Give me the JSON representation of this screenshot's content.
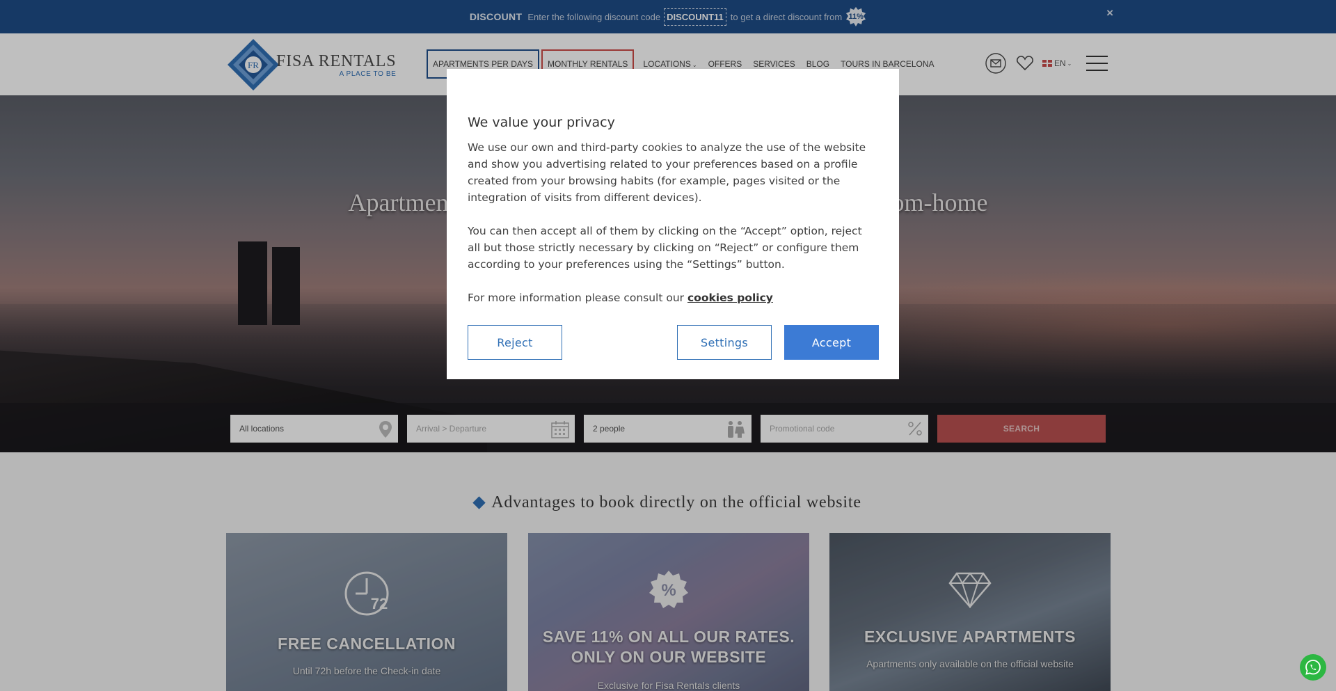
{
  "topbar": {
    "label": "DISCOUNT",
    "text_before": "Enter the following discount code",
    "code": "DISCOUNT11",
    "text_after": "to get a direct discount from",
    "badge": "11%",
    "close": "×"
  },
  "header": {
    "logo_mark": "FR",
    "logo_name": "FISA RENTALS",
    "logo_tagline": "A PLACE TO BE",
    "nav": {
      "apartments_per_days": "APARTMENTS PER DAYS",
      "monthly_rentals": "MONTHLY RENTALS",
      "locations": "LOCATIONS",
      "offers": "OFFERS",
      "services": "SERVICES",
      "blog": "BLOG",
      "tours": "TOURS IN BARCELONA"
    },
    "language": "EN"
  },
  "hero": {
    "title_left": "Apartment",
    "title_right": "rom-home"
  },
  "search": {
    "location_value": "All locations",
    "dates_placeholder": "Arrival > Departure",
    "people_value": "2 people",
    "promo_placeholder": "Promotional code",
    "button": "SEARCH"
  },
  "advantages": {
    "title": "Advantages to book directly on the official website",
    "cards": [
      {
        "title": "FREE CANCELLATION",
        "subtitle": "Until 72h before the Check-in date",
        "icon_text": "72"
      },
      {
        "title_line1": "SAVE 11% ON ALL OUR RATES.",
        "title_line2": "ONLY ON OUR WEBSITE",
        "subtitle": "Exclusive for Fisa Rentals clients",
        "icon_text": "%"
      },
      {
        "title": "EXCLUSIVE APARTMENTS",
        "subtitle": "Apartments only available on the official website"
      }
    ]
  },
  "cookie_modal": {
    "title": "We value your privacy",
    "paragraph1_lines": [
      "We use our own and third-party cookies to analyze the use of the website",
      "and show you advertising related to your preferences based on a profile",
      "created from your browsing habits (for example, pages visited or the",
      "integration of visits from different devices)."
    ],
    "paragraph2_lines": [
      "You can then accept all of them by clicking on the “Accept” option, reject",
      "all but those strictly necessary by clicking on “Reject” or configure them",
      "according to your preferences using the “Settings” button."
    ],
    "more_info": "For more information please consult our",
    "policy_link": "cookies policy",
    "reject": "Reject",
    "settings": "Settings",
    "accept": "Accept"
  },
  "colors": {
    "topbar": "#1e4c87",
    "brand_blue": "#2f6fb5",
    "accept_button": "#3c7bd5",
    "search_button": "#ba5150",
    "monthly_border": "#cc4b47",
    "whatsapp": "#2cb742"
  },
  "icons": [
    "close-icon",
    "mail-icon",
    "heart-icon",
    "uk-flag-icon",
    "chevron-down-icon",
    "menu-icon",
    "location-pin-icon",
    "calendar-icon",
    "people-icon",
    "percent-icon",
    "clock-72-icon",
    "percent-badge-icon",
    "diamond-icon",
    "whatsapp-icon"
  ]
}
